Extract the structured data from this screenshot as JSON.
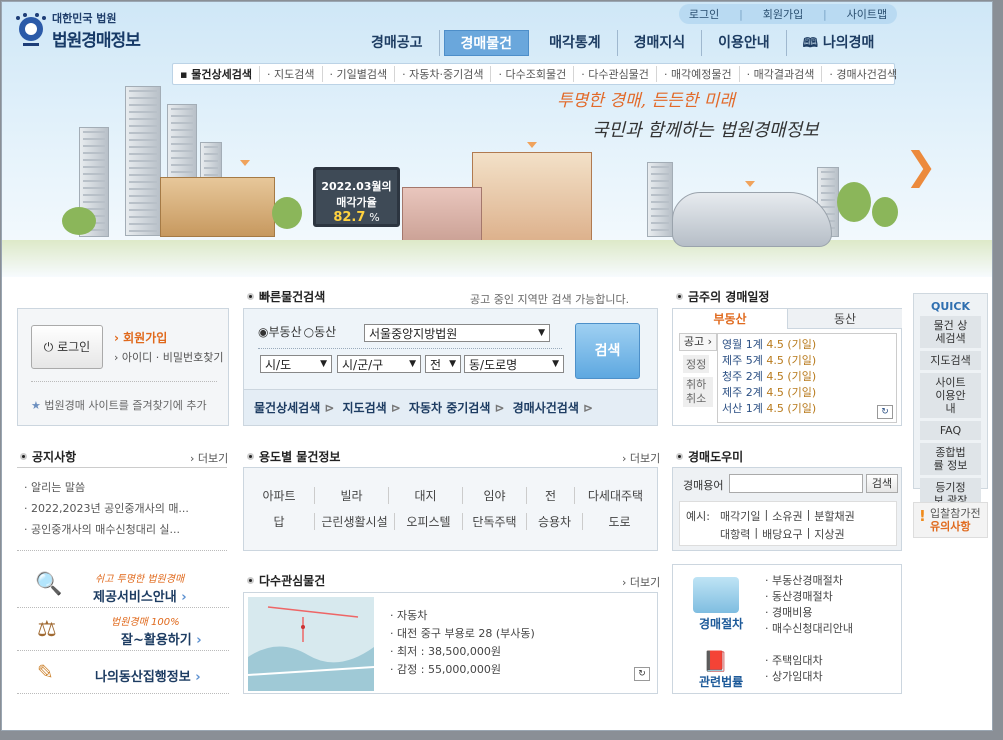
{
  "header": {
    "topbar": [
      "로그인",
      "회원가입",
      "사이트맵"
    ],
    "logo_sub": "대한민국 법원",
    "logo_title": "법원경매정보"
  },
  "gnb": [
    "경매공고",
    "경매물건",
    "매각통계",
    "경매지식",
    "이용안내",
    "나의경매"
  ],
  "snb": [
    "물건상세검색",
    "지도검색",
    "기일별검색",
    "자동차·중기검색",
    "다수조회물건",
    "다수관심물건",
    "매각예정물건",
    "매각결과검색",
    "경매사건검색"
  ],
  "hero": {
    "slogan1": "투명한 경매, 든든한 미래",
    "slogan2": "국민과 함께하는 법원경매정보",
    "billboard_line1": "2022.03월의",
    "billboard_line2": "매각가율",
    "billboard_rate": "82.7",
    "billboard_unit": "%"
  },
  "login": {
    "button": "로그인",
    "join": "회원가입",
    "find": "아이디 · 비밀번호찾기",
    "favorite": "법원경매 사이트를 즐겨찾기에 추가"
  },
  "quick_search": {
    "title": "빠른물건검색",
    "note": "공고 중인 지역만 검색 가능합니다.",
    "radio1": "부동산",
    "radio2": "동산",
    "court": "서울중앙지방법원",
    "sido": "시/도",
    "sigungu": "시/군/구",
    "jeon": "전",
    "dong": "동/도로명",
    "search": "검색",
    "links": [
      "물건상세검색",
      "지도검색",
      "자동차 중기검색",
      "경매사건검색"
    ]
  },
  "schedule": {
    "title": "금주의 경매일정",
    "tab1": "부동산",
    "tab2": "동산",
    "side": [
      "공고",
      "정정",
      "취하",
      "취소"
    ],
    "rows": [
      {
        "court": "영월 1계",
        "val": "4.5 (기일)"
      },
      {
        "court": "제주 5계",
        "val": "4.5 (기일)"
      },
      {
        "court": "청주 2계",
        "val": "4.5 (기일)"
      },
      {
        "court": "제주 2계",
        "val": "4.5 (기일)"
      },
      {
        "court": "서산 1계",
        "val": "4.5 (기일)"
      }
    ]
  },
  "quick_menu": {
    "title": "QUICK",
    "items": [
      "물건 상세검색",
      "지도검색",
      "사이트 이용안내",
      "FAQ",
      "종합법률 정보",
      "등기정보 광장"
    ],
    "notice": "입찰참가전",
    "notice2": "유의사항"
  },
  "notice": {
    "title": "공지사항",
    "more": "더보기",
    "items": [
      "알리는 말씀",
      "2022,2023년 공인중개사의 매...",
      "공인중개사의 매수신청대리 실..."
    ]
  },
  "usage": {
    "title": "용도별 물건정보",
    "more": "더보기",
    "row1": [
      "아파트",
      "빌라",
      "대지",
      "임야",
      "전",
      "다세대주택"
    ],
    "row2": [
      "답",
      "근린생활시설",
      "오피스텔",
      "단독주택",
      "승용차",
      "도로"
    ]
  },
  "helper": {
    "title": "경매도우미",
    "label": "경매용어",
    "search": "검색",
    "example": "예시:",
    "words1": [
      "매각기일",
      "소유권",
      "분할채권"
    ],
    "words2": [
      "대항력",
      "배당요구",
      "지상권"
    ]
  },
  "services": [
    {
      "small": "쉬고 투명한 법원경매",
      "big": "제공서비스안내"
    },
    {
      "small": "법원경매 100%",
      "big": "잘~활용하기"
    },
    {
      "small": "",
      "big": "나의동산집행정보"
    }
  ],
  "interest": {
    "title": "다수관심물건",
    "more": "더보기",
    "items": [
      "자동차",
      "대전 중구 부용로 28 (부사동)",
      "최저 : 38,500,000원",
      "감정 : 55,000,000원"
    ]
  },
  "procedure": {
    "label1": "경매절차",
    "links1": [
      "부동산경매절차",
      "동산경매절차",
      "경매비용",
      "매수신청대리안내"
    ],
    "label2": "관련법률",
    "links2": [
      "주택임대차",
      "상가임대차"
    ]
  }
}
